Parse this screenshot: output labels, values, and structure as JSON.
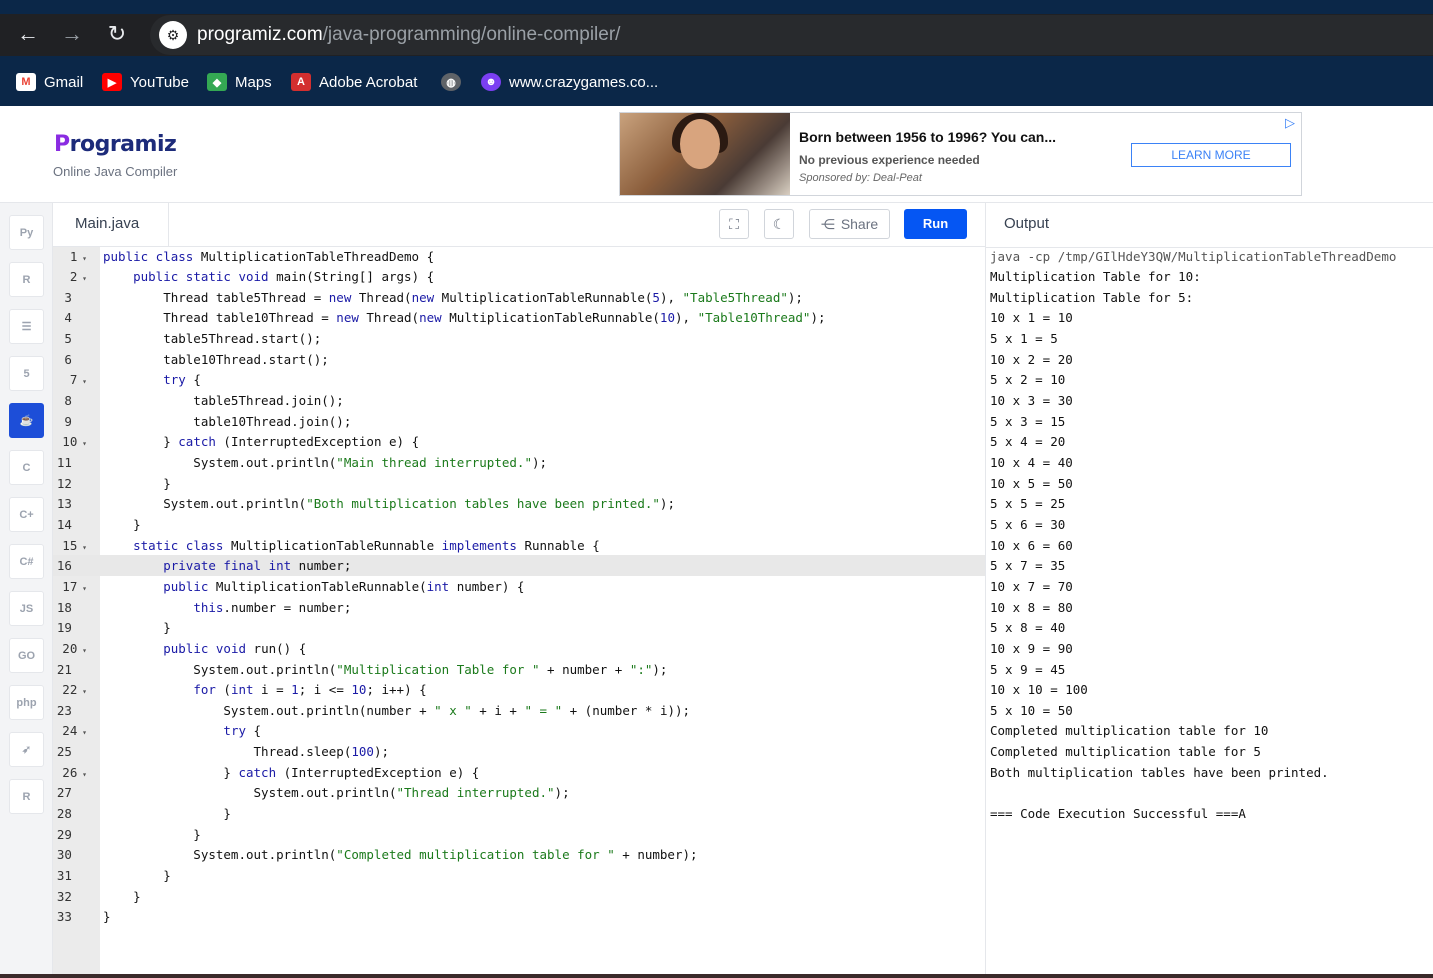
{
  "browser": {
    "url_host": "programiz.com",
    "url_path": "/java-programming/online-compiler/",
    "bookmarks": [
      {
        "label": "Gmail",
        "icon": "gmail-icon"
      },
      {
        "label": "YouTube",
        "icon": "youtube-icon"
      },
      {
        "label": "Maps",
        "icon": "maps-icon"
      },
      {
        "label": "Adobe Acrobat",
        "icon": "acrobat-icon"
      },
      {
        "label": "",
        "icon": "globe-icon"
      },
      {
        "label": "www.crazygames.co...",
        "icon": "crazygames-icon"
      }
    ]
  },
  "header": {
    "logo_first": "P",
    "logo_rest": "rogramiz",
    "subtitle": "Online Java Compiler"
  },
  "ad": {
    "title": "Born between 1956 to 1996? You can...",
    "description": "No previous experience needed",
    "sponsor": "Sponsored by: Deal-Peat",
    "button": "LEARN MORE"
  },
  "sidebar": {
    "languages": [
      {
        "name": "python",
        "label": "Py"
      },
      {
        "name": "r",
        "label": "R"
      },
      {
        "name": "sql",
        "label": "☰"
      },
      {
        "name": "html",
        "label": "5"
      },
      {
        "name": "java",
        "label": "☕",
        "active": true
      },
      {
        "name": "c",
        "label": "C"
      },
      {
        "name": "cpp",
        "label": "C+"
      },
      {
        "name": "csharp",
        "label": "C#"
      },
      {
        "name": "js",
        "label": "JS"
      },
      {
        "name": "go",
        "label": "GO"
      },
      {
        "name": "php",
        "label": "php"
      },
      {
        "name": "swift",
        "label": "➶"
      },
      {
        "name": "rust",
        "label": "R"
      }
    ]
  },
  "editor": {
    "filename": "Main.java",
    "share_label": "Share",
    "run_label": "Run",
    "active_line": 16
  },
  "output": {
    "title": "Output",
    "lines": [
      "java -cp /tmp/GIlHdeY3QW/MultiplicationTableThreadDemo",
      "Multiplication Table for 10:",
      "Multiplication Table for 5:",
      "10 x 1 = 10",
      "5 x 1 = 5",
      "10 x 2 = 20",
      "5 x 2 = 10",
      "10 x 3 = 30",
      "5 x 3 = 15",
      "5 x 4 = 20",
      "10 x 4 = 40",
      "10 x 5 = 50",
      "5 x 5 = 25",
      "5 x 6 = 30",
      "10 x 6 = 60",
      "5 x 7 = 35",
      "10 x 7 = 70",
      "10 x 8 = 80",
      "5 x 8 = 40",
      "10 x 9 = 90",
      "5 x 9 = 45",
      "10 x 10 = 100",
      "5 x 10 = 50",
      "Completed multiplication table for 10",
      "Completed multiplication table for 5",
      "Both multiplication tables have been printed.",
      "",
      "=== Code Execution Successful ===A"
    ]
  }
}
